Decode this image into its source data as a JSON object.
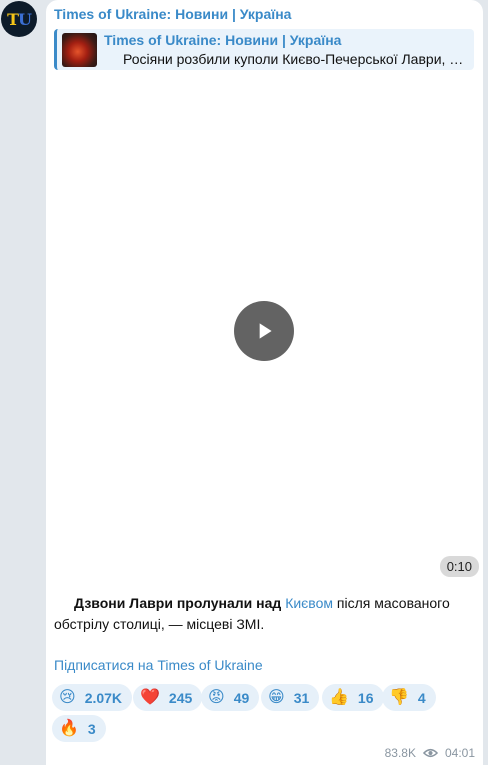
{
  "avatar": {
    "letters_left": "T",
    "letters_right": "U"
  },
  "channel": {
    "name": "Times of Ukraine: Новини | Україна"
  },
  "reply": {
    "title": "Times of Ukraine: Новини | Україна",
    "text": "Росіяни розбили куполи Києво-Печерської Лаври, …"
  },
  "video": {
    "duration": "0:10"
  },
  "caption": {
    "bold": "Дзвони Лаври пролунали над",
    "link": "Києвом",
    "rest": " після масованого обстрілу столиці, — місцеві ЗМІ."
  },
  "subscribe": {
    "label": "Підписатися на Times of Ukraine"
  },
  "reactions": [
    {
      "emoji": "😢",
      "count": "2.07K"
    },
    {
      "emoji": "❤️",
      "count": "245"
    },
    {
      "emoji": "😡",
      "count": "49"
    },
    {
      "emoji": "😁",
      "count": "31"
    },
    {
      "emoji": "👍",
      "count": "16"
    },
    {
      "emoji": "👎",
      "count": "4"
    },
    {
      "emoji": "🔥",
      "count": "3"
    }
  ],
  "meta": {
    "views": "83.8K",
    "time": "04:01"
  },
  "colors": {
    "accent": "#3a8ac8",
    "bubble": "#ffffff",
    "background": "#e2e7ec",
    "reaction_bg": "#e6f0f9"
  }
}
